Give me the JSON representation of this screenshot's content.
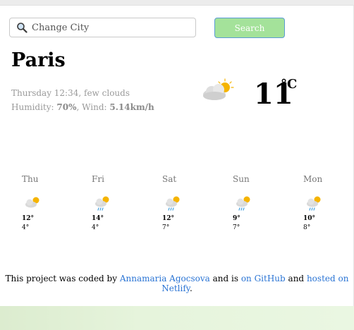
{
  "search": {
    "placeholder": "Change City",
    "button_label": "Search"
  },
  "current": {
    "city": "Paris",
    "datetime": "Thursday 12:34",
    "description": "few clouds",
    "humidity_label": "Humidity:",
    "humidity_value": "70%",
    "wind_label": "Wind:",
    "wind_value": "5.14km/h",
    "temperature": "11",
    "unit": "°C",
    "icon": "few-clouds-icon"
  },
  "forecast": [
    {
      "day": "Thu",
      "high": "12°",
      "low": "4°",
      "icon": "few-clouds-icon"
    },
    {
      "day": "Fri",
      "high": "14°",
      "low": "4°",
      "icon": "rain-icon"
    },
    {
      "day": "Sat",
      "high": "12°",
      "low": "7°",
      "icon": "rain-icon"
    },
    {
      "day": "Sun",
      "high": "9°",
      "low": "7°",
      "icon": "rain-icon"
    },
    {
      "day": "Mon",
      "high": "10°",
      "low": "8°",
      "icon": "rain-icon"
    }
  ],
  "footer": {
    "text_1": "This project was coded by",
    "author_link": "Annamaria Agocsova",
    "text_2": "and is",
    "github_link": "on GitHub",
    "text_3": "and",
    "netlify_link": "hosted on Netlify",
    "text_4": "."
  },
  "colors": {
    "button_bg": "#a4e29a",
    "button_border": "#5b9bd5",
    "link": "#2a74d4",
    "sun": "#f5b400"
  }
}
